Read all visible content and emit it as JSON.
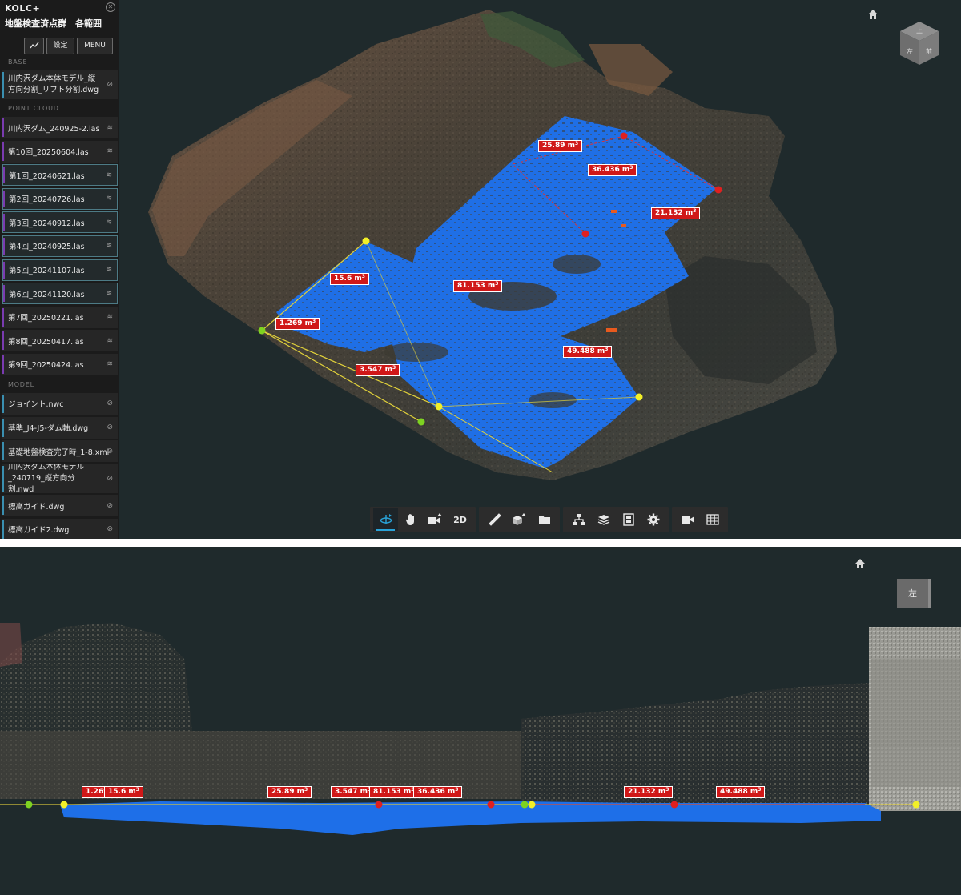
{
  "sidebar": {
    "logo": "KOLC+",
    "title": "地盤検査済点群　各範囲",
    "buttons": {
      "settings": "設定",
      "menu": "MENU"
    },
    "sections": {
      "base": "BASE",
      "point_cloud": "POINT CLOUD",
      "model": "MODEL"
    },
    "base_items": [
      {
        "label": "川内沢ダム本体モデル_縦方向分割_リフト分割.dwg",
        "icon": "external-link-icon"
      }
    ],
    "point_cloud_items": [
      {
        "label": "川内沢ダム_240925-2.las",
        "icon": "layers-icon",
        "selected": false,
        "bar": "#7a3bb0"
      },
      {
        "label": "第10回_20250604.las",
        "icon": "layers-icon",
        "selected": false,
        "bar": "#7a3bb0"
      },
      {
        "label": "第1回_20240621.las",
        "icon": "layers-icon",
        "selected": true,
        "bar": "#7a3bb0"
      },
      {
        "label": "第2回_20240726.las",
        "icon": "layers-icon",
        "selected": true,
        "bar": "#7a3bb0"
      },
      {
        "label": "第3回_20240912.las",
        "icon": "layers-icon",
        "selected": true,
        "bar": "#7a3bb0"
      },
      {
        "label": "第4回_20240925.las",
        "icon": "layers-icon",
        "selected": true,
        "bar": "#7a3bb0"
      },
      {
        "label": "第5回_20241107.las",
        "icon": "layers-icon",
        "selected": true,
        "bar": "#7a3bb0"
      },
      {
        "label": "第6回_20241120.las",
        "icon": "layers-icon",
        "selected": true,
        "bar": "#7a3bb0"
      },
      {
        "label": "第7回_20250221.las",
        "icon": "layers-icon",
        "selected": false,
        "bar": "#7a3bb0"
      },
      {
        "label": "第8回_20250417.las",
        "icon": "layers-icon",
        "selected": false,
        "bar": "#7a3bb0"
      },
      {
        "label": "第9回_20250424.las",
        "icon": "layers-icon",
        "selected": false,
        "bar": "#7a3bb0"
      }
    ],
    "model_items": [
      {
        "label": "ジョイント.nwc",
        "icon": "external-link-icon"
      },
      {
        "label": "基準_J4-J5-ダム軸.dwg",
        "icon": "external-link-icon"
      },
      {
        "label": "基礎地盤検査完了時_1-8.xml",
        "icon": "external-link-icon"
      },
      {
        "label": "川内沢ダム本体モデル_240719_縦方向分割.nwd",
        "icon": "external-link-icon"
      },
      {
        "label": "標高ガイド.dwg",
        "icon": "external-link-icon"
      },
      {
        "label": "標高ガイド2.dwg",
        "icon": "external-link-icon"
      }
    ]
  },
  "navcube_top": {
    "faces": [
      "上",
      "左",
      "前"
    ]
  },
  "navcube_bottom": {
    "label": "左"
  },
  "toolbar": {
    "groups": [
      [
        {
          "name": "orbit-icon",
          "active": true
        },
        {
          "name": "pan-hand-icon"
        },
        {
          "name": "camera-view-icon"
        },
        {
          "name": "view-2d-button",
          "label": "2D"
        }
      ],
      [
        {
          "name": "measure-ruler-icon"
        },
        {
          "name": "box-section-icon"
        },
        {
          "name": "folder-icon"
        }
      ],
      [
        {
          "name": "hierarchy-icon"
        },
        {
          "name": "layers-icon"
        },
        {
          "name": "properties-icon"
        },
        {
          "name": "settings-gear-icon"
        }
      ],
      [
        {
          "name": "video-camera-icon"
        },
        {
          "name": "table-grid-icon"
        }
      ]
    ]
  },
  "volumes_top": [
    {
      "value": "25.89",
      "unit": "m",
      "exp": "3"
    },
    {
      "value": "36.436",
      "unit": "m",
      "exp": "3"
    },
    {
      "value": "21.132",
      "unit": "m",
      "exp": "3"
    },
    {
      "value": "15.6",
      "unit": "m",
      "exp": "3"
    },
    {
      "value": "81.153",
      "unit": "m",
      "exp": "3"
    },
    {
      "value": "1.269",
      "unit": "m",
      "exp": "3"
    },
    {
      "value": "49.488",
      "unit": "m",
      "exp": "3"
    },
    {
      "value": "3.547",
      "unit": "m",
      "exp": "3"
    }
  ],
  "volumes_bottom": [
    {
      "value": "1.269",
      "unit": "m",
      "exp": "3"
    },
    {
      "value": "15.6",
      "unit": "m",
      "exp": "3"
    },
    {
      "value": "25.89",
      "unit": "m",
      "exp": "3"
    },
    {
      "value": "3.547",
      "unit": "m",
      "exp": "3"
    },
    {
      "value": "81.153",
      "unit": "m",
      "exp": "3"
    },
    {
      "value": "36.436",
      "unit": "m",
      "exp": "3"
    },
    {
      "value": "21.132",
      "unit": "m",
      "exp": "3"
    },
    {
      "value": "49.488",
      "unit": "m",
      "exp": "3"
    }
  ],
  "colors": {
    "accent": "#29a3d8",
    "volume_label": "#d01818",
    "point_blue": "#1e6fe8",
    "background": "#1f2a2c"
  }
}
